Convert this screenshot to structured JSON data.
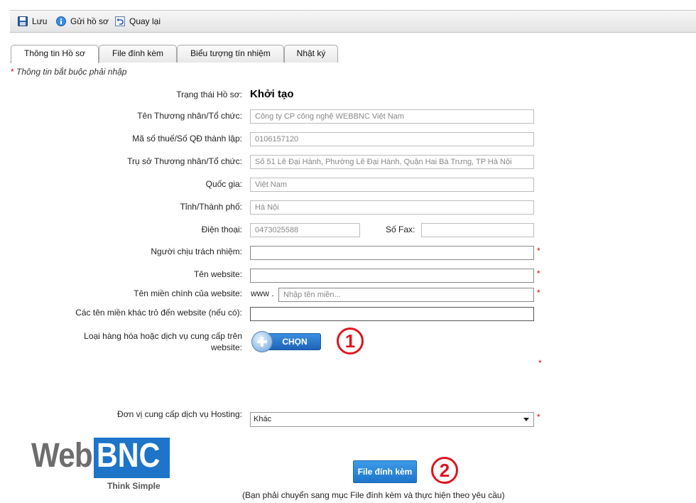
{
  "toolbar": {
    "save_label": "Lưu",
    "submit_label": "Gửi hồ sơ",
    "back_label": "Quay lại"
  },
  "tabs": [
    {
      "label": "Thông tin Hồ sơ",
      "active": true
    },
    {
      "label": "File đính kèm",
      "active": false
    },
    {
      "label": "Biểu tượng tín nhiệm",
      "active": false
    },
    {
      "label": "Nhật ký",
      "active": false
    }
  ],
  "required_note": {
    "star": "*",
    "text": " Thông tin bắt buộc phải nhập"
  },
  "form": {
    "status_label": "Trạng thái Hồ sơ:",
    "status_value": "Khởi tạo",
    "merchant_name_label": "Tên Thương nhân/Tổ chức:",
    "merchant_name_value": "Công ty CP công nghệ WEBBNC Việt Nam",
    "tax_id_label": "Mã số thuế/Số QĐ thành lập:",
    "tax_id_value": "0106157120",
    "address_label": "Trụ sở Thương nhân/Tổ chức:",
    "address_value": "Số 51 Lê Đại Hành, Phường Lê Đại Hành, Quận Hai Bà Trưng, TP Hà Nội",
    "country_label": "Quốc gia:",
    "country_value": "Việt Nam",
    "province_label": "Tỉnh/Thành phố:",
    "province_value": "Hà Nội",
    "phone_label": "Điện thoại:",
    "phone_value": "0473025588",
    "fax_label": "Số Fax:",
    "fax_value": "",
    "responsible_label": "Người chịu trách nhiệm:",
    "responsible_value": "",
    "website_name_label": "Tên website:",
    "website_name_value": "",
    "main_domain_label": "Tên miền chính của website:",
    "main_domain_prefix": "www .",
    "main_domain_placeholder": "Nhập tên miền...",
    "other_domains_label": "Các tên miền khác trỏ đến website (nếu có):",
    "other_domains_value": "",
    "goods_label_line1": "Loại hàng hóa hoặc dịch vụ cung cấp trên",
    "goods_label_line2": "website:",
    "choose_button": "CHỌN",
    "hosting_label": "Đơn vị cung cấp dịch vụ Hosting:",
    "hosting_selected": "Khác",
    "required_mark": "*"
  },
  "annotations": {
    "step1": "1",
    "step2": "2"
  },
  "attach_button": "File đính kèm",
  "bottom_note": "(Bạn phải chuyển sang mục File đính kèm và thực hiện theo yêu cầu)",
  "logo": {
    "part1": "Web",
    "part2": "BNC",
    "tagline": "Think Simple"
  },
  "colors": {
    "accent": "#1d74c9",
    "required": "#dd0000",
    "annotation": "#e0141e"
  }
}
